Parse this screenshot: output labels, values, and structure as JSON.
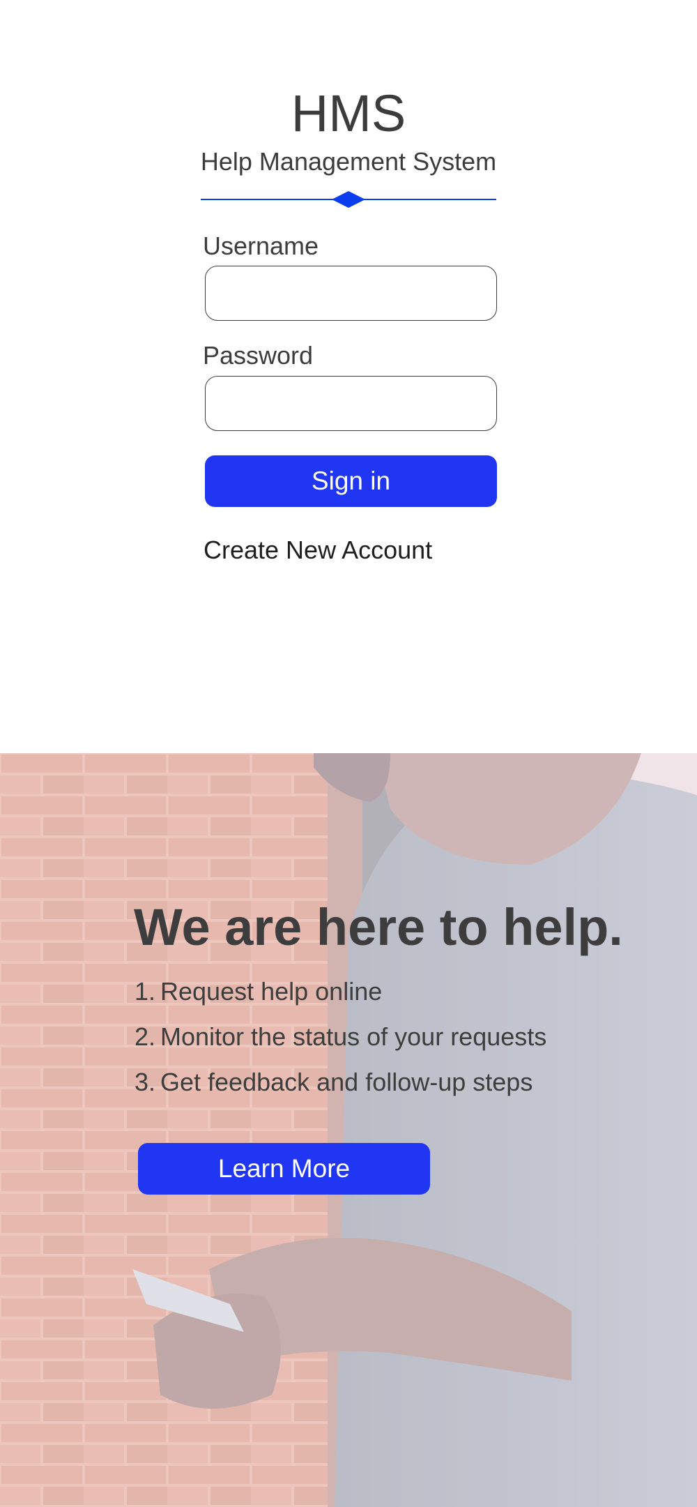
{
  "login": {
    "app_title": "HMS",
    "app_subtitle": "Help Management System",
    "username_label": "Username",
    "username_value": "",
    "password_label": "Password",
    "password_value": "",
    "signin_label": "Sign in",
    "create_account_label": "Create New Account"
  },
  "hero": {
    "headline": "We are here to help.",
    "steps": [
      {
        "number": "1.",
        "text": "Request help online"
      },
      {
        "number": "2.",
        "text": "Monitor the status of your requests"
      },
      {
        "number": "3.",
        "text": "Get feedback and follow-up steps"
      }
    ],
    "learn_more_label": "Learn More",
    "background_image": "person-holding-phone-photo"
  },
  "colors": {
    "accent": "#2136f2",
    "divider": "#0a3cf0",
    "text": "#3c3c3c"
  }
}
